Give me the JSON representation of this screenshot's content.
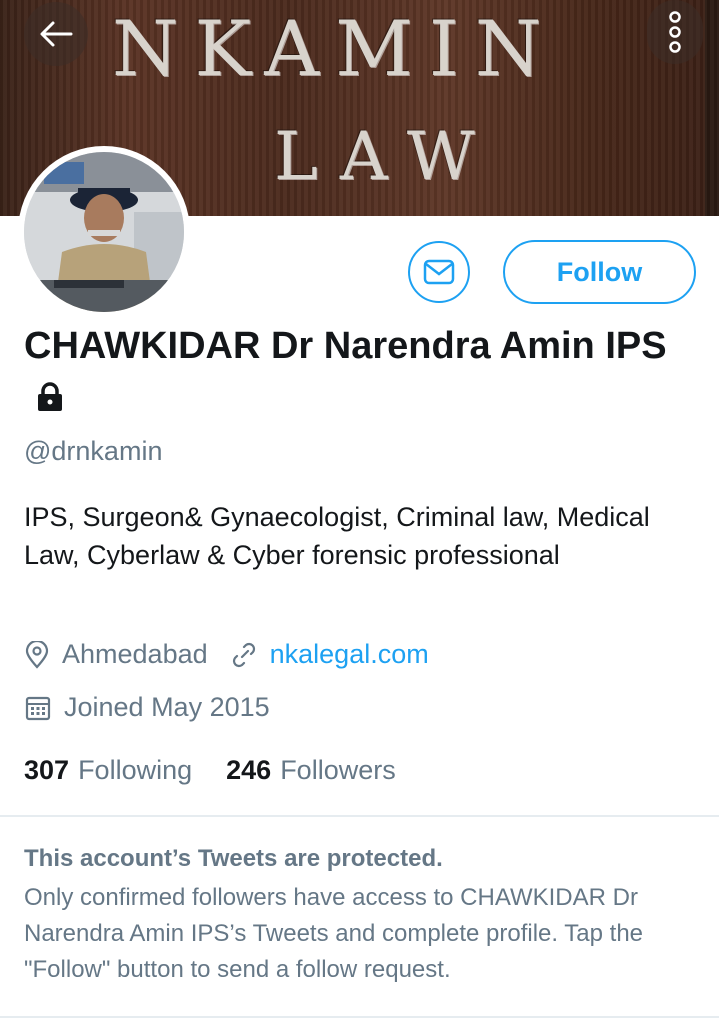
{
  "banner": {
    "line1": "NKAMIN",
    "line2": "LAW"
  },
  "profile": {
    "name": "CHAWKIDAR Dr Narendra Amin IPS",
    "handle": "@drnkamin",
    "bio": "IPS,  Surgeon& Gynaecologist,  Criminal law, Medical Law,  Cyberlaw & Cyber forensic professional",
    "location": "Ahmedabad",
    "website": "nkalegal.com",
    "joined": "Joined May 2015",
    "following_count": "307",
    "following_label": "Following",
    "followers_count": "246",
    "followers_label": "Followers"
  },
  "actions": {
    "follow_label": "Follow"
  },
  "protected": {
    "title": "This account’s Tweets are protected.",
    "body": "Only confirmed followers have access to CHAWKIDAR Dr Narendra Amin IPS’s Tweets and complete profile. Tap the \"Follow\" button to send a follow request."
  },
  "colors": {
    "accent": "#1da1f2",
    "secondary_text": "#657786",
    "primary_text": "#14171a"
  },
  "icons": [
    "back-arrow-icon",
    "more-vertical-icon",
    "envelope-icon",
    "lock-icon",
    "location-pin-icon",
    "link-icon",
    "calendar-icon"
  ]
}
